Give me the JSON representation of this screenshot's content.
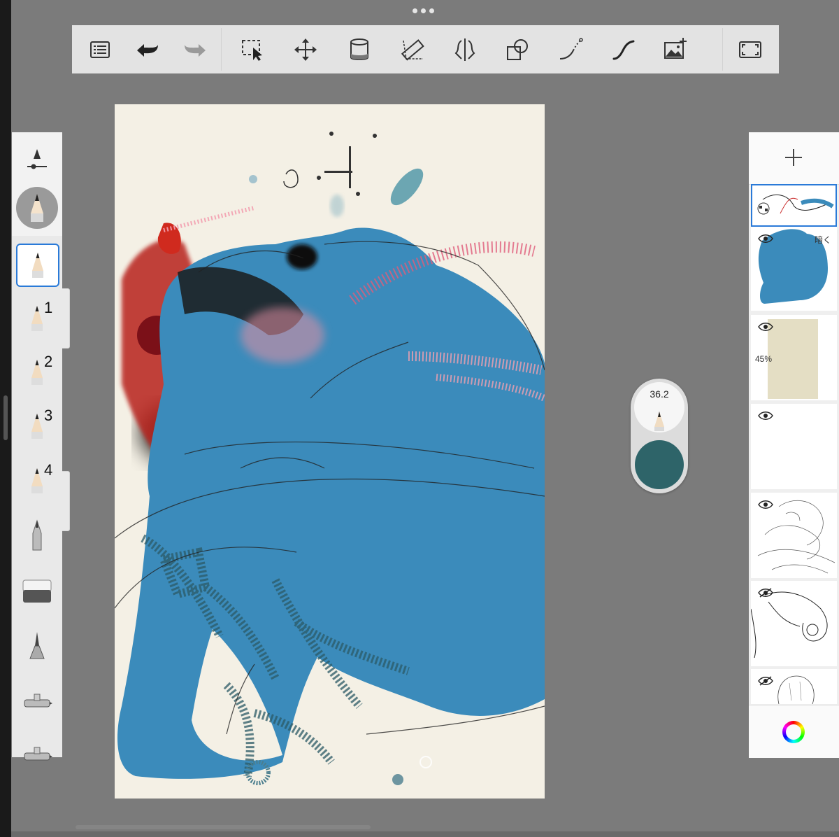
{
  "toolbar": {
    "tools": [
      {
        "name": "list-icon"
      },
      {
        "name": "undo-icon"
      },
      {
        "name": "redo-icon"
      },
      {
        "name": "selection-icon"
      },
      {
        "name": "transform-move-icon"
      },
      {
        "name": "fill-bucket-icon"
      },
      {
        "name": "ruler-icon"
      },
      {
        "name": "symmetry-icon"
      },
      {
        "name": "shape-icon"
      },
      {
        "name": "predictive-stroke-icon"
      },
      {
        "name": "stroke-curve-icon"
      },
      {
        "name": "add-image-icon"
      },
      {
        "name": "fullscreen-icon"
      }
    ]
  },
  "brushes": {
    "selected_index": 0,
    "items": [
      {
        "name": "pencil",
        "num": ""
      },
      {
        "name": "pencil-1",
        "num": "1"
      },
      {
        "name": "pencil-2",
        "num": "2"
      },
      {
        "name": "pencil-3",
        "num": "3"
      },
      {
        "name": "pencil-4",
        "num": "4"
      },
      {
        "name": "ink-pen",
        "num": ""
      },
      {
        "name": "eraser",
        "num": ""
      },
      {
        "name": "marker",
        "num": ""
      },
      {
        "name": "airbrush",
        "num": ""
      },
      {
        "name": "airbrush-2",
        "num": ""
      }
    ]
  },
  "puck": {
    "brush_size": "36.2",
    "color": "#2e6469"
  },
  "layers": {
    "items": [
      {
        "name": "layer-sketch-top",
        "visible": true,
        "selected": true,
        "label": ""
      },
      {
        "name": "layer-blue-fill",
        "visible": true,
        "selected": false,
        "label": "暗く"
      },
      {
        "name": "layer-beige",
        "visible": true,
        "selected": false,
        "label": "45%"
      },
      {
        "name": "layer-empty",
        "visible": true,
        "selected": false,
        "label": ""
      },
      {
        "name": "layer-line-sketch",
        "visible": true,
        "selected": false,
        "label": ""
      },
      {
        "name": "layer-ink-sketch",
        "visible": false,
        "selected": false,
        "label": ""
      },
      {
        "name": "layer-head-sketch",
        "visible": false,
        "selected": false,
        "label": ""
      }
    ]
  },
  "colors": {
    "canvas_bg": "#f4f0e5",
    "figure_blue": "#3b8bbb",
    "accent_blue": "#2a7ad8",
    "red_paint": "#c3261c",
    "pink_paint": "#f0a0a8"
  }
}
